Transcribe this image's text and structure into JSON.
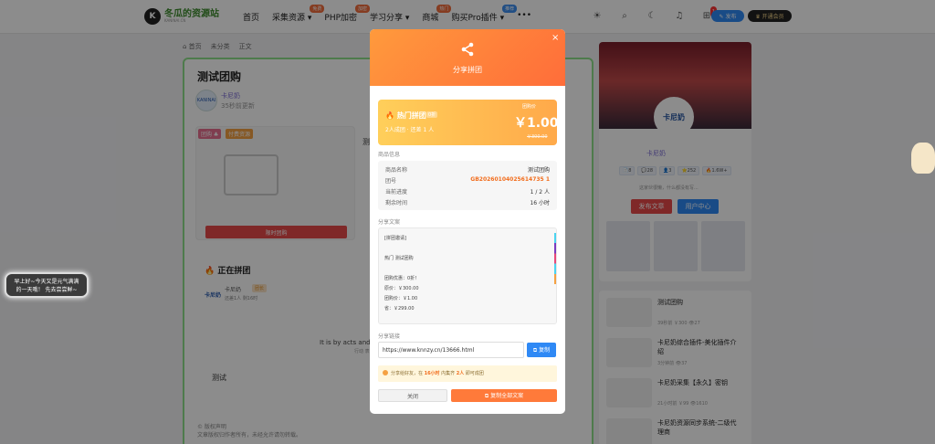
{
  "header": {
    "logo_text": "冬瓜的资源站",
    "logo_sub": "KANINAI.CN",
    "nav": [
      {
        "label": "首页",
        "badge": ""
      },
      {
        "label": "采集资源 ▾",
        "badge": "免费"
      },
      {
        "label": "PHP加密",
        "badge": "加密"
      },
      {
        "label": "学习分享 ▾",
        "badge": ""
      },
      {
        "label": "商城",
        "badge": "热门"
      },
      {
        "label": "购买Pro插件 ▾",
        "badge": "推荐"
      },
      {
        "label": "•••",
        "badge": ""
      }
    ],
    "cart_count": "1",
    "post_label": "✎ 发布",
    "vip_label": "♛ 开通会员"
  },
  "breadcrumb": {
    "home": "⌂ 首页",
    "cat": "未分类",
    "cur": "正文"
  },
  "article": {
    "title": "测试团购",
    "author": "卡尼奶",
    "author_avatar": "KANINAI",
    "time": "35秒前更新",
    "tag_group": "团购 ♣",
    "tag_res": "付费资源",
    "limit_button": "限时团购",
    "partial": "测",
    "ongoing_title": "🔥 正在拼团",
    "ongoing_name": "卡尼奶",
    "ongoing_tag": "团长",
    "ongoing_desc": "还差1人 剩16时",
    "ongoing_logo": "卡尼奶",
    "body_text": "It is by acts and",
    "body_sub": "行动 表现",
    "test_text": "测试",
    "copyright": "© 版权声明\n文章版权归作者所有，未经允许请勿转载。"
  },
  "toast": "早上好~今天又是元气满满\n的一天哦！ 先去尝尝鲜~",
  "sidebar": {
    "avatar": "卡尼奶",
    "name": "卡尼奶",
    "stats": [
      "📄8",
      "💬28",
      "👤3",
      "⭐252",
      "🔥1.6W+"
    ],
    "desc": "这家伙很懒，什么都没有写...",
    "btn_post": "发布文章",
    "btn_user": "用户中心"
  },
  "list": [
    {
      "title": "测试团购",
      "meta": "39秒前   ￥300   👁27"
    },
    {
      "title": "卡尼奶综合插件-美化插件介绍",
      "meta": "3分钟前   👁37"
    },
    {
      "title": "卡尼奶采集【永久】密钥",
      "meta": "21小时前   ￥99   👁1610"
    },
    {
      "title": "卡尼奶资源同步系统-二级代理商",
      "meta": ""
    }
  ],
  "modal": {
    "title": "分享拼团",
    "close": "×",
    "hot": "🔥 热门拼团",
    "discount": "0折",
    "group_info": "2人成团 · 还差 1 人",
    "price_label": "团购价",
    "price": "￥1.00",
    "orig_price": "￥300.00",
    "section_goods": "商品信息",
    "rows": [
      {
        "k": "商品名称",
        "v": "测试团购"
      },
      {
        "k": "团号",
        "v": "GB20260104025614735 1"
      },
      {
        "k": "当前进度",
        "v": "1 / 2 人"
      },
      {
        "k": "剩余时间",
        "v": "16 小时"
      }
    ],
    "section_copy": "分享文案",
    "copy_lines": [
      "[拼团邀请]",
      "",
      "热门 测试团购",
      "",
      "团购优惠：0折！",
      "原价：￥300.00",
      "团购价：￥1.00",
      "省：￥299.00"
    ],
    "section_link": "分享链接",
    "link": "https://www.knnzy.cn/13666.html",
    "copy_btn": "⧉ 复制",
    "tip_pre": "分享给好友，在 ",
    "tip_hours": "16小时",
    "tip_mid": " 内集齐 ",
    "tip_people": "2人",
    "tip_post": " 即可成团",
    "btn_close": "关闭",
    "btn_copyall": "⧉ 复制全部文案"
  }
}
